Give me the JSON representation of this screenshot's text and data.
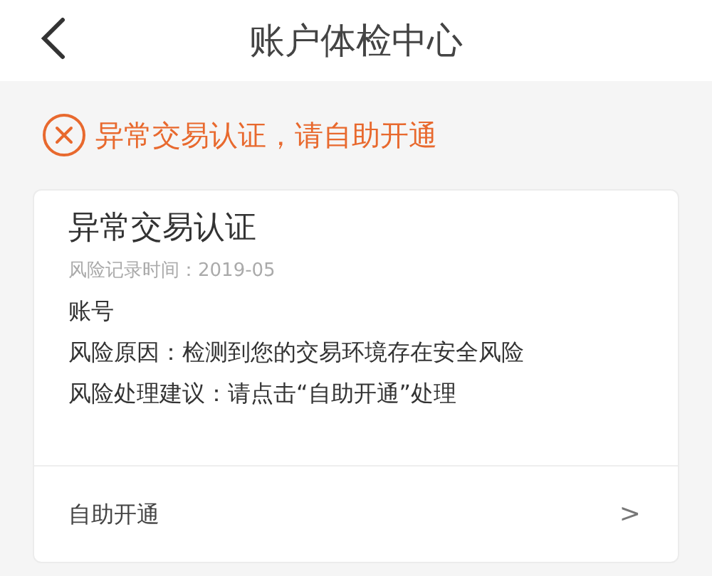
{
  "header": {
    "title": "账户体检中心"
  },
  "alert": {
    "text": "异常交易认证，请自助开通"
  },
  "card": {
    "title": "异常交易认证",
    "record_time": "风险记录时间：2019-05",
    "lines": [
      "账号",
      "风险原因：检测到您的交易环境存在安全风险",
      "风险处理建议：请点击“自助开通”处理"
    ],
    "action": {
      "label": "自助开通",
      "arrow": ">"
    }
  }
}
